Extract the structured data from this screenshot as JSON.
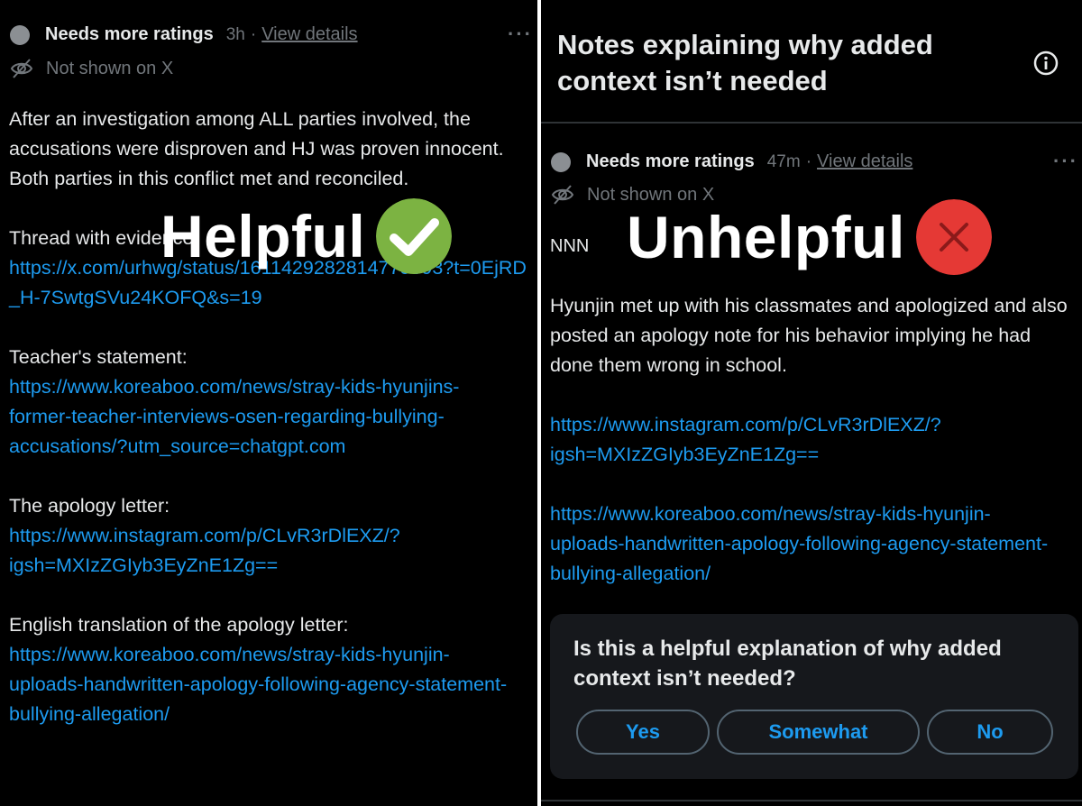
{
  "left": {
    "status": "Needs more ratings",
    "time": "3h",
    "separator": "·",
    "view_details": "View details",
    "more": "···",
    "not_shown": "Not shown on X",
    "note_text": "After an investigation among ALL parties involved, the accusations were disproven and HJ was proven innocent. Both parties in this conflict met and reconciled.",
    "sections": [
      {
        "label": "Thread with evidence:",
        "link": "https://x.com/urhwg/status/1611429282814779393?t=0EjRD_H-7SwtgSVu24KOFQ&s=19"
      },
      {
        "label": "Teacher's statement:",
        "link": "https://www.koreaboo.com/news/stray-kids-hyunjins-former-teacher-interviews-osen-regarding-bullying-accusations/?utm_source=chatgpt.com"
      },
      {
        "label": "The apology letter:",
        "link": "https://www.instagram.com/p/CLvR3rDlEXZ/?igsh=MXIzZGIyb3EyZnE1Zg=="
      },
      {
        "label": "English translation of the apology letter:",
        "link": "https://www.koreaboo.com/news/stray-kids-hyunjin-uploads-handwritten-apology-following-agency-statement-bullying-allegation/"
      }
    ],
    "stamp": "Helpful"
  },
  "right": {
    "header": "Notes explaining why added context isn’t needed",
    "status": "Needs more ratings",
    "time": "47m",
    "separator": "·",
    "view_details": "View details",
    "more": "···",
    "not_shown": "Not shown on X",
    "nnn": "NNN",
    "stamp": "Unhelpful",
    "note_text": "Hyunjin met up with his classmates and apologized and also posted an apology note for his behavior implying he had done them wrong in school.",
    "links": [
      "https://www.instagram.com/p/CLvR3rDlEXZ/?igsh=MXIzZGIyb3EyZnE1Zg==",
      "https://www.koreaboo.com/news/stray-kids-hyunjin-uploads-handwritten-apology-following-agency-statement-bullying-allegation/"
    ],
    "rating": {
      "question": "Is this a helpful explanation of why added context isn’t needed?",
      "yes": "Yes",
      "somewhat": "Somewhat",
      "no": "No"
    }
  },
  "colors": {
    "background": "#000000",
    "text": "#e7e9ea",
    "muted": "#71767b",
    "link": "#1d9bf0",
    "helpful_badge": "#7cb342",
    "unhelpful_badge": "#e53935"
  },
  "icons": [
    "eye-slash-icon",
    "info-icon",
    "checkmark-icon",
    "x-mark-icon",
    "more-options-icon"
  ]
}
